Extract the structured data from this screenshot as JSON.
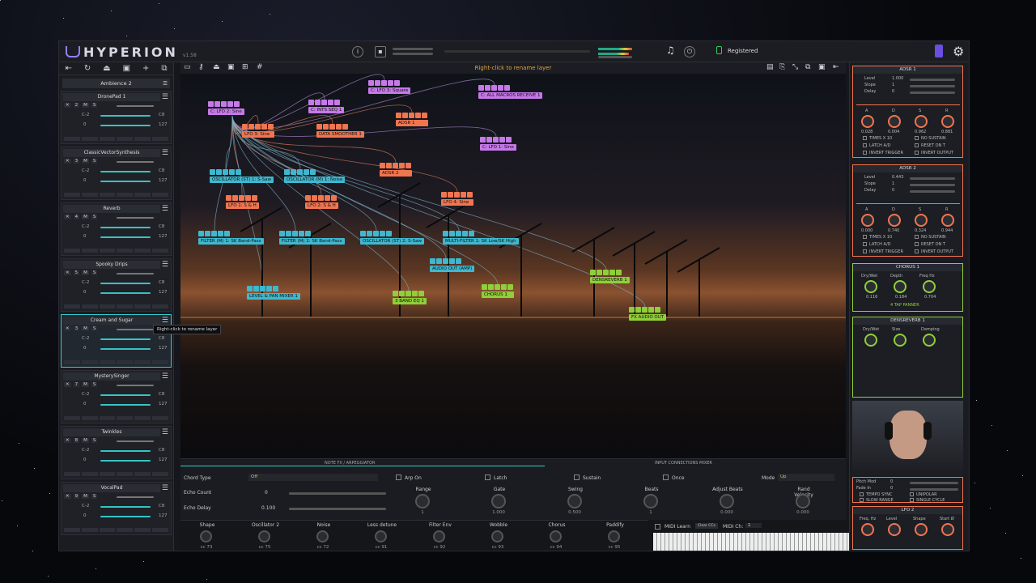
{
  "app": {
    "name": "HYPERION",
    "version": "v1.58",
    "status": "Registered",
    "top_message": "Right-click to rename layer"
  },
  "left": {
    "preset": "Ambience 2",
    "tooltip": "Right-click to rename layer",
    "layers": [
      {
        "name": "DronePad 1",
        "num": "2",
        "lo": "C-2",
        "hi": "C8",
        "v0": "0",
        "v1": "127"
      },
      {
        "name": "ClassicVectorSynthesis",
        "num": "3",
        "lo": "C-2",
        "hi": "C8",
        "v0": "0",
        "v1": "127"
      },
      {
        "name": "Reverb",
        "num": "4",
        "lo": "C-2",
        "hi": "C8",
        "v0": "0",
        "v1": "127"
      },
      {
        "name": "Spooky Drips",
        "num": "5",
        "lo": "C-2",
        "hi": "C8",
        "v0": "0",
        "v1": "127"
      },
      {
        "name": "Cream and Sugar",
        "num": "3",
        "lo": "C-2",
        "hi": "C8",
        "v0": "0",
        "v1": "127"
      },
      {
        "name": "MysterySinger",
        "num": "7",
        "lo": "C-2",
        "hi": "C8",
        "v0": "0",
        "v1": "127"
      },
      {
        "name": "Twinkles",
        "num": "8",
        "lo": "C-2",
        "hi": "C8",
        "v0": "0",
        "v1": "127"
      },
      {
        "name": "VocalPad",
        "num": "9",
        "lo": "C-2",
        "hi": "C8",
        "v0": "0",
        "v1": "127"
      }
    ]
  },
  "nodes": [
    {
      "label": "C: LFO 2: Sine",
      "c": "p"
    },
    {
      "label": "C: INTS SEQ 1",
      "c": "p"
    },
    {
      "label": "C: LFO 3: Square",
      "c": "p"
    },
    {
      "label": "C: ALL MACROS RECEIVE 1",
      "c": "p"
    },
    {
      "label": "LFO 3: Sine",
      "c": "o"
    },
    {
      "label": "DATA SMOOTHER 1",
      "c": "o"
    },
    {
      "label": "ADSR 1",
      "c": "o"
    },
    {
      "label": "C: LFO 1: Sine",
      "c": "p"
    },
    {
      "label": "ADSR 2",
      "c": "o"
    },
    {
      "label": "OSCILLATOR (ST) 1: S-Saw",
      "c": "b"
    },
    {
      "label": "OSCILLATOR (M) 1: Noise",
      "c": "b"
    },
    {
      "label": "LFO 1: S & H",
      "c": "o"
    },
    {
      "label": "LFO 2: S & H",
      "c": "o"
    },
    {
      "label": "LFO 4: Sine",
      "c": "o"
    },
    {
      "label": "FILTER (M) 1: SK Band-Pass",
      "c": "b"
    },
    {
      "label": "FILTER (M) 2: SK Band-Pass",
      "c": "b"
    },
    {
      "label": "OSCILLATOR (ST) 2: S-Saw",
      "c": "b"
    },
    {
      "label": "MULTI-FILTER 1: SK Low/SK High",
      "c": "b"
    },
    {
      "label": "AUDIO OUT (AMP)",
      "c": "b"
    },
    {
      "label": "DENSREVERB 1",
      "c": "g"
    },
    {
      "label": "LEVEL & PAN MIXER 1",
      "c": "b"
    },
    {
      "label": "3 BAND EQ 1",
      "c": "g"
    },
    {
      "label": "CHORUS 1",
      "c": "g"
    },
    {
      "label": "FX AUDIO OUT",
      "c": "g"
    }
  ],
  "bottom": {
    "tab1": "NOTE FX / ARPEGGIATOR",
    "tab2": "INPUT CONNECTIONS MIXER",
    "chord_label": "Chord Type",
    "chord_value": "Off",
    "echo_count_label": "Echo Count",
    "echo_count": "0",
    "echo_delay_label": "Echo Delay",
    "echo_delay": "0.100",
    "checks": [
      "Arp On",
      "Latch",
      "Sustain",
      "Once"
    ],
    "mode_label": "Mode",
    "mode_value": "Up",
    "knobs": [
      {
        "l": "Range",
        "v": "1"
      },
      {
        "l": "Gate",
        "v": "1.000"
      },
      {
        "l": "Swing",
        "v": "0.500"
      },
      {
        "l": "Beats",
        "v": "1"
      },
      {
        "l": "Adjust Beats",
        "v": "0.000"
      },
      {
        "l": "Rand Velocity",
        "v": "0.000"
      }
    ]
  },
  "macros": [
    {
      "l": "Shape",
      "cc": "cc 73"
    },
    {
      "l": "Oscillator 2",
      "cc": "cc 75"
    },
    {
      "l": "Noise",
      "cc": "cc 72"
    },
    {
      "l": "Less detune",
      "cc": "cc 91"
    },
    {
      "l": "Filter Env",
      "cc": "cc 92"
    },
    {
      "l": "Wobble",
      "cc": "cc 93"
    },
    {
      "l": "Chorus",
      "cc": "cc 94"
    },
    {
      "l": "Paddify",
      "cc": "cc 95"
    }
  ],
  "piano": {
    "midi_learn": "MIDI Learn",
    "clear": "Clear CCs",
    "midi_ch": "MIDI Ch:",
    "ch_val": "1"
  },
  "right": {
    "adsr1": {
      "title": "ADSR 1",
      "level": "1.000",
      "slope": "1",
      "delay": "0",
      "vals": [
        "0.028",
        "0.004",
        "0.962",
        "0.881"
      ]
    },
    "adsr2": {
      "title": "ADSR 2",
      "level": "0.443",
      "slope": "1",
      "delay": "0",
      "vals": [
        "0.000",
        "0.740",
        "0.324",
        "0.944"
      ]
    },
    "adsr_knobs": [
      "A",
      "D",
      "S",
      "R"
    ],
    "adsr_opts": [
      "TIMES X 10",
      "NO SUSTAIN",
      "LATCH A/D",
      "RESET ON T",
      "INVERT TRIGGER",
      "INVERT OUTPUT"
    ],
    "row_labels": [
      "Level",
      "Slope",
      "Delay"
    ],
    "chorus": {
      "title": "CHORUS 1",
      "k": [
        "Dry/Wet",
        "Depth",
        "Freq Hz"
      ],
      "v": [
        "0.116",
        "0.184",
        "0.704"
      ],
      "sel": "4 TAP PANNER"
    },
    "dens": {
      "title": "DENSREVERB 1",
      "k": [
        "Dry/Wet",
        "Size",
        "Damping"
      ]
    },
    "pitch": {
      "pm": "Pitch Mod",
      "pm_v": "0",
      "fi": "Fade In",
      "fi_v": "0",
      "opts": [
        "TEMPO SYNC",
        "UNIPOLAR",
        "SLOW RANGE",
        "SINGLE CYCLE"
      ]
    },
    "lfo2": {
      "title": "LFO 2",
      "k": [
        "Freq. Hz",
        "Level",
        "Shape",
        "Start Ø"
      ]
    }
  }
}
